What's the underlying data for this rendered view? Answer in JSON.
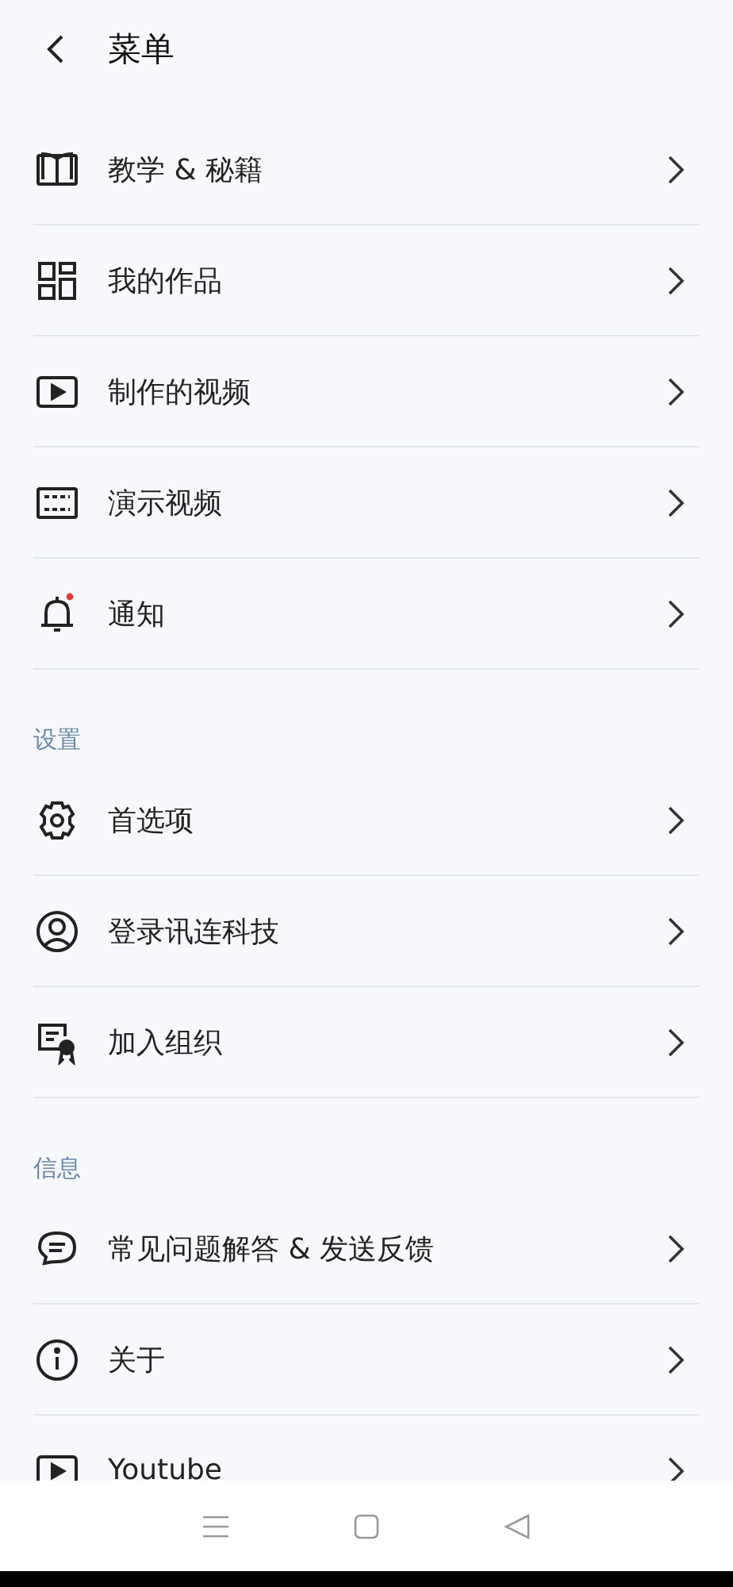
{
  "header": {
    "title": "菜单"
  },
  "sections": [
    {
      "items": [
        {
          "kind": "book",
          "label": "教学 & 秘籍",
          "badge": false
        },
        {
          "kind": "grid",
          "label": "我的作品",
          "badge": false
        },
        {
          "kind": "play",
          "label": "制作的视频",
          "badge": false
        },
        {
          "kind": "film",
          "label": "演示视频",
          "badge": false
        },
        {
          "kind": "bell",
          "label": "通知",
          "badge": true
        }
      ]
    },
    {
      "title": "设置",
      "items": [
        {
          "kind": "gear",
          "label": "首选项",
          "badge": false
        },
        {
          "kind": "user",
          "label": "登录讯连科技",
          "badge": false
        },
        {
          "kind": "cert",
          "label": "加入组织",
          "badge": false
        }
      ]
    },
    {
      "title": "信息",
      "items": [
        {
          "kind": "chat",
          "label": "常见问题解答 & 发送反馈",
          "badge": false
        },
        {
          "kind": "info",
          "label": "关于",
          "badge": false
        },
        {
          "kind": "play",
          "label": "Youtube",
          "badge": false
        }
      ]
    }
  ]
}
